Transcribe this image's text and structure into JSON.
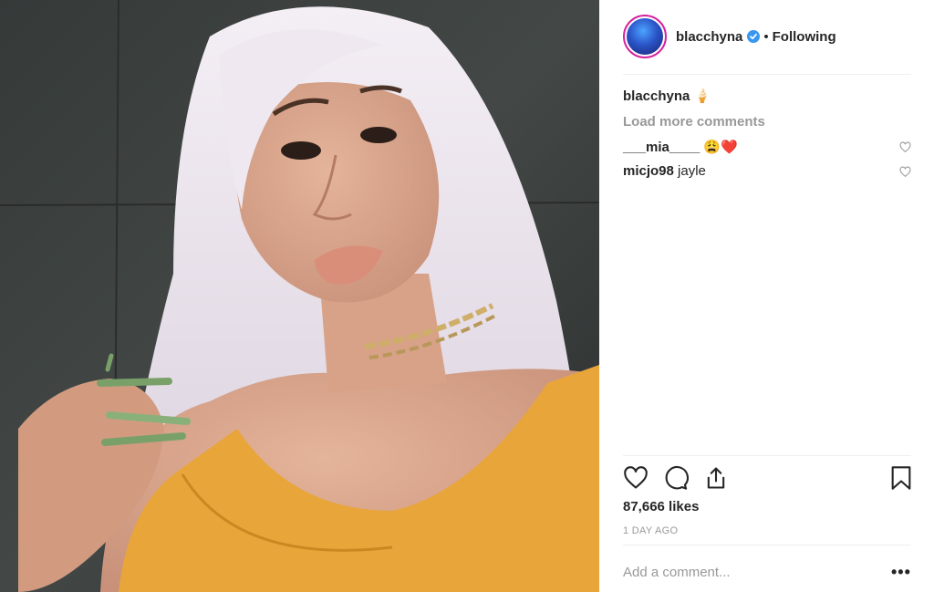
{
  "post": {
    "username": "blacchyna",
    "follow_state": "Following",
    "dot": "•",
    "caption_username": "blacchyna",
    "caption_emoji": "🍦",
    "load_more": "Load more comments",
    "comments": [
      {
        "username": "___mia____",
        "text": "😩❤️"
      },
      {
        "username": "micjo98",
        "text": "jayle"
      }
    ],
    "likes": "87,666 likes",
    "time_ago": "1 DAY AGO",
    "add_comment_placeholder": "Add a comment...",
    "more_label": "•••"
  },
  "colors": {
    "text": "#262626",
    "muted": "#999999",
    "verified": "#3897f0",
    "shirt": "#e8a53a",
    "hair": "#ede6ee"
  }
}
